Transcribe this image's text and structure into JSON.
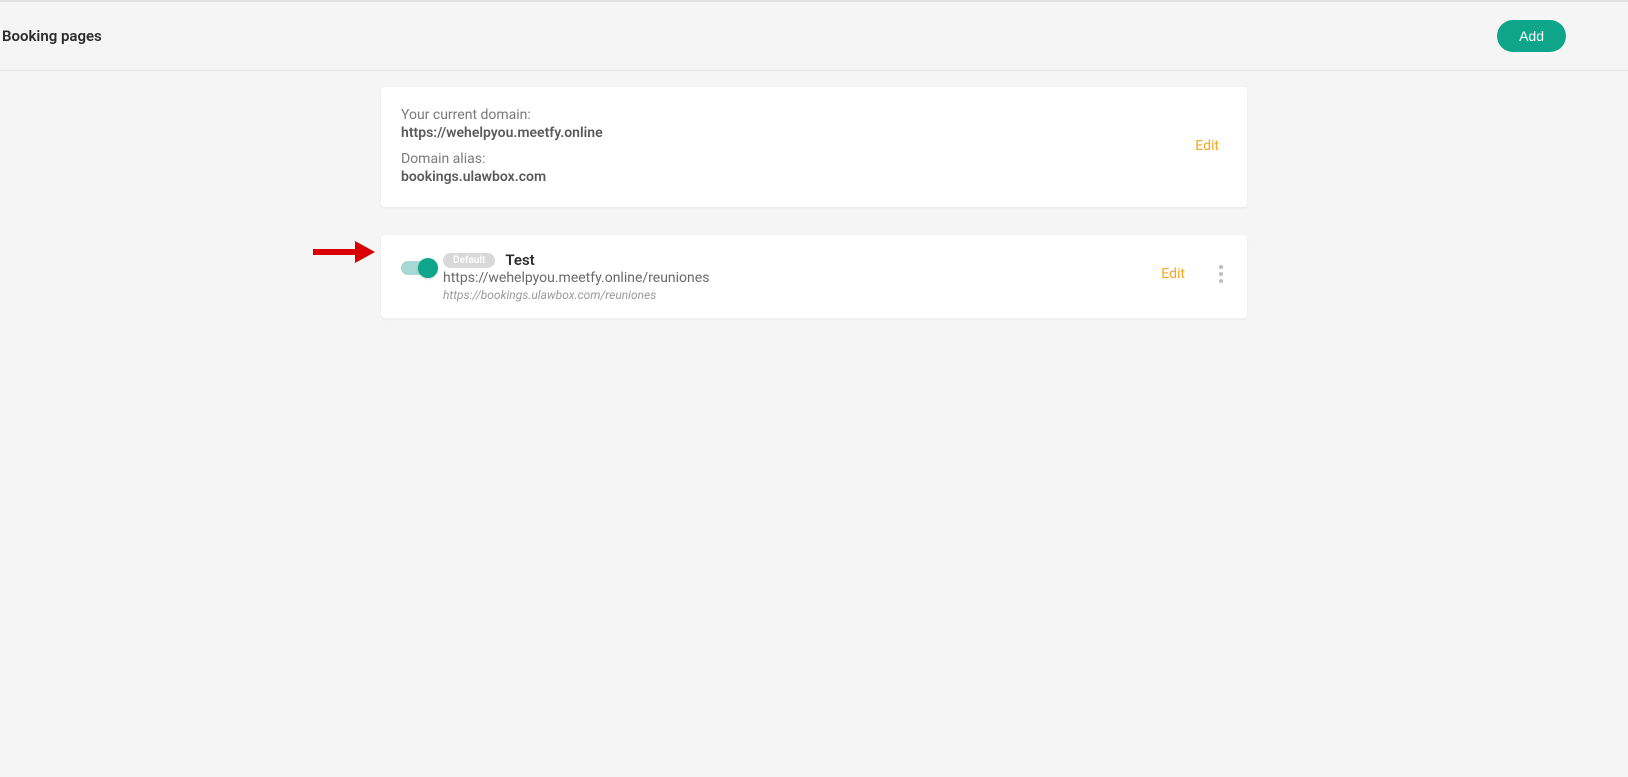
{
  "header": {
    "title": "Booking pages",
    "add_button": "Add"
  },
  "domain_card": {
    "current_domain_label": "Your current domain:",
    "current_domain_value": "https://wehelpyou.meetfy.online",
    "alias_label": "Domain alias:",
    "alias_value": "bookings.ulawbox.com",
    "edit_label": "Edit"
  },
  "booking_item": {
    "default_badge": "Default",
    "title": "Test",
    "url": "https://wehelpyou.meetfy.online/reuniones",
    "alias_url": "https://bookings.ulawbox.com/reuniones",
    "edit_label": "Edit"
  }
}
